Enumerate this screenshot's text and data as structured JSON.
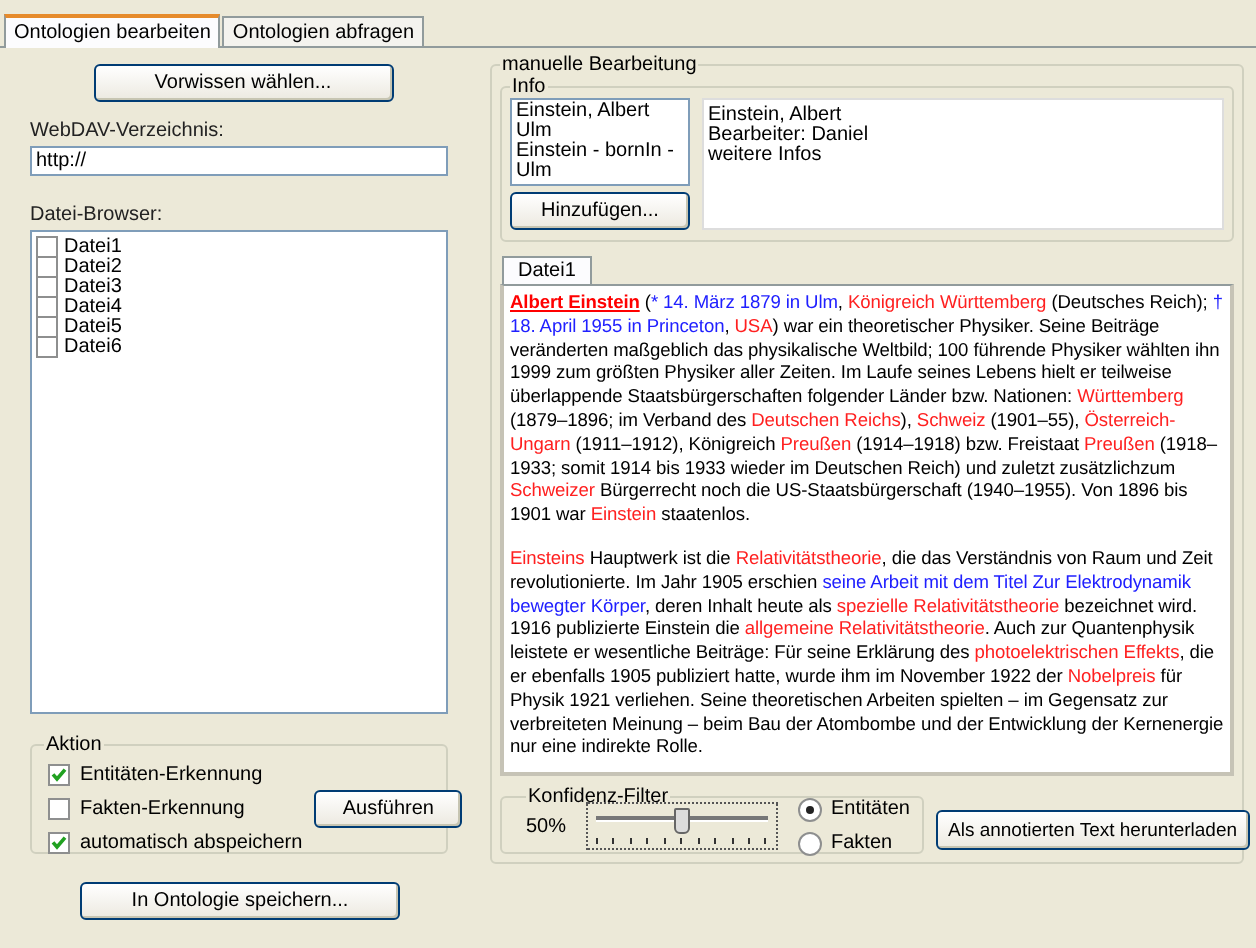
{
  "tabs": [
    {
      "label": "Ontologien bearbeiten",
      "selected": true
    },
    {
      "label": "Ontologien abfragen",
      "selected": false
    }
  ],
  "left": {
    "prior_button": "Vorwissen wählen...",
    "webdav": {
      "label": "WebDAV-Verzeichnis:",
      "value": "http://"
    },
    "file_browser": {
      "label": "Datei-Browser:",
      "files": [
        {
          "label": "Datei1",
          "checked": false
        },
        {
          "label": "Datei2",
          "checked": false
        },
        {
          "label": "Datei3",
          "checked": false
        },
        {
          "label": "Datei4",
          "checked": false
        },
        {
          "label": "Datei5",
          "checked": false
        },
        {
          "label": "Datei6",
          "checked": false
        }
      ]
    },
    "action": {
      "title": "Aktion",
      "options": [
        {
          "label": "Entitäten-Erkennung",
          "checked": true
        },
        {
          "label": "Fakten-Erkennung",
          "checked": false
        },
        {
          "label": "automatisch abspeichern",
          "checked": true
        }
      ],
      "run_button": "Ausführen"
    },
    "save_button": "In Ontologie speichern..."
  },
  "manual": {
    "title": "manuelle Bearbeitung",
    "info": {
      "title": "Info",
      "items": [
        "Einstein, Albert",
        "Ulm",
        "Einstein - bornIn - Ulm"
      ],
      "add_button": "Hinzufügen...",
      "details": [
        "Einstein, Albert",
        "Bearbeiter: Daniel",
        "weitere Infos"
      ]
    },
    "doc_tabs": [
      {
        "label": "Datei1",
        "selected": true
      }
    ],
    "paragraphs": [
      [
        {
          "kind": "heading",
          "text": "Albert Einstein"
        },
        {
          "kind": "text",
          "text": " ("
        },
        {
          "kind": "fact",
          "text": "* 14. März 1879 in Ulm"
        },
        {
          "kind": "text",
          "text": ", "
        },
        {
          "kind": "entity",
          "text": "Königreich Württemberg"
        },
        {
          "kind": "text",
          "text": " (Deutsches Reich); "
        },
        {
          "kind": "fact",
          "text": "† 18. April 1955 in Princeton"
        },
        {
          "kind": "text",
          "text": ", "
        },
        {
          "kind": "entity",
          "text": "USA"
        },
        {
          "kind": "text",
          "text": ") war ein theoretischer Physiker. Seine Beiträge veränderten maßgeblich das physikalische Weltbild; 100 führende Physiker wählten ihn 1999 zum größten Physiker aller Zeiten. Im Laufe seines Lebens hielt er teilweise überlappende Staatsbürgerschaften folgender Länder bzw. Nationen: "
        },
        {
          "kind": "entity",
          "text": "Württemberg"
        },
        {
          "kind": "text",
          "text": " (1879–1896; im Verband des "
        },
        {
          "kind": "entity",
          "text": "Deutschen Reichs"
        },
        {
          "kind": "text",
          "text": "), "
        },
        {
          "kind": "entity",
          "text": "Schweiz"
        },
        {
          "kind": "text",
          "text": " (1901–55), "
        },
        {
          "kind": "entity",
          "text": "Österreich-Ungarn"
        },
        {
          "kind": "text",
          "text": " (1911–1912), Königreich "
        },
        {
          "kind": "entity",
          "text": "Preußen"
        },
        {
          "kind": "text",
          "text": " (1914–1918) bzw. Freistaat "
        },
        {
          "kind": "entity",
          "text": "Preußen"
        },
        {
          "kind": "text",
          "text": " (1918–1933; somit 1914 bis 1933 wieder im Deutschen Reich) und zuletzt zusätzlichzum "
        },
        {
          "kind": "entity",
          "text": "Schweizer"
        },
        {
          "kind": "text",
          "text": " Bürgerrecht noch die US-Staatsbürgerschaft (1940–1955). Von 1896 bis 1901 war "
        },
        {
          "kind": "entity",
          "text": "Einstein"
        },
        {
          "kind": "text",
          "text": " staatenlos."
        }
      ],
      [
        {
          "kind": "entity",
          "text": "Einsteins"
        },
        {
          "kind": "text",
          "text": " Hauptwerk ist die "
        },
        {
          "kind": "entity",
          "text": "Relativitätstheorie"
        },
        {
          "kind": "text",
          "text": ", die das Verständnis von Raum und Zeit revolutionierte. Im Jahr 1905 erschien "
        },
        {
          "kind": "fact",
          "text": "seine Arbeit mit dem Titel Zur Elektrodynamik bewegter Körper"
        },
        {
          "kind": "text",
          "text": ", deren Inhalt heute als "
        },
        {
          "kind": "entity",
          "text": "spezielle Relativitätstheorie"
        },
        {
          "kind": "text",
          "text": " bezeichnet wird. 1916 publizierte Einstein die "
        },
        {
          "kind": "entity",
          "text": "allgemeine Relativitätstheorie"
        },
        {
          "kind": "text",
          "text": ". Auch zur Quantenphysik leistete er wesentliche Beiträge: Für seine Erklärung des "
        },
        {
          "kind": "entity",
          "text": "photoelektrischen Effekts"
        },
        {
          "kind": "text",
          "text": ", die er ebenfalls 1905 publiziert hatte, wurde ihm im November 1922 der "
        },
        {
          "kind": "entity",
          "text": "Nobelpreis"
        },
        {
          "kind": "text",
          "text": " für Physik 1921 verliehen. Seine theoretischen Arbeiten spielten – im Gegensatz zur verbreiteten Meinung – beim Bau der Atombombe und der Entwicklung der Kernenergie nur eine indirekte Rolle."
        }
      ]
    ],
    "confidence": {
      "title": "Konfidenz-Filter",
      "reading": "50%",
      "level": 0.5,
      "modes": [
        {
          "label": "Entitäten",
          "selected": true
        },
        {
          "label": "Fakten",
          "selected": false
        }
      ]
    },
    "download_button": "Als annotierten Text herunterladen"
  }
}
